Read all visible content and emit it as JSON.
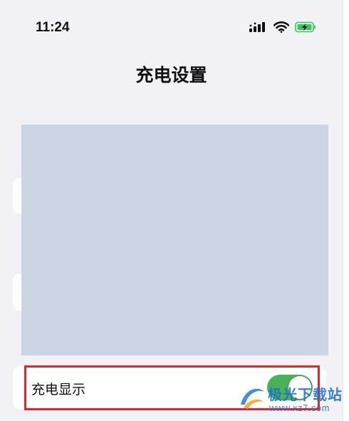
{
  "status_bar": {
    "time": "11:24",
    "icons": [
      "cellular-signal-icon",
      "wifi-icon",
      "battery-charging-icon"
    ],
    "battery_color": "#34c759"
  },
  "header": {
    "title": "充电设置"
  },
  "settings": {
    "charging_display": {
      "label": "充电显示",
      "enabled": true,
      "toggle_color": "#47b257"
    }
  },
  "annotation": {
    "highlight_color": "#e2262c"
  },
  "watermark": {
    "brand": "极光下载站",
    "url": "www.xz7.com"
  }
}
